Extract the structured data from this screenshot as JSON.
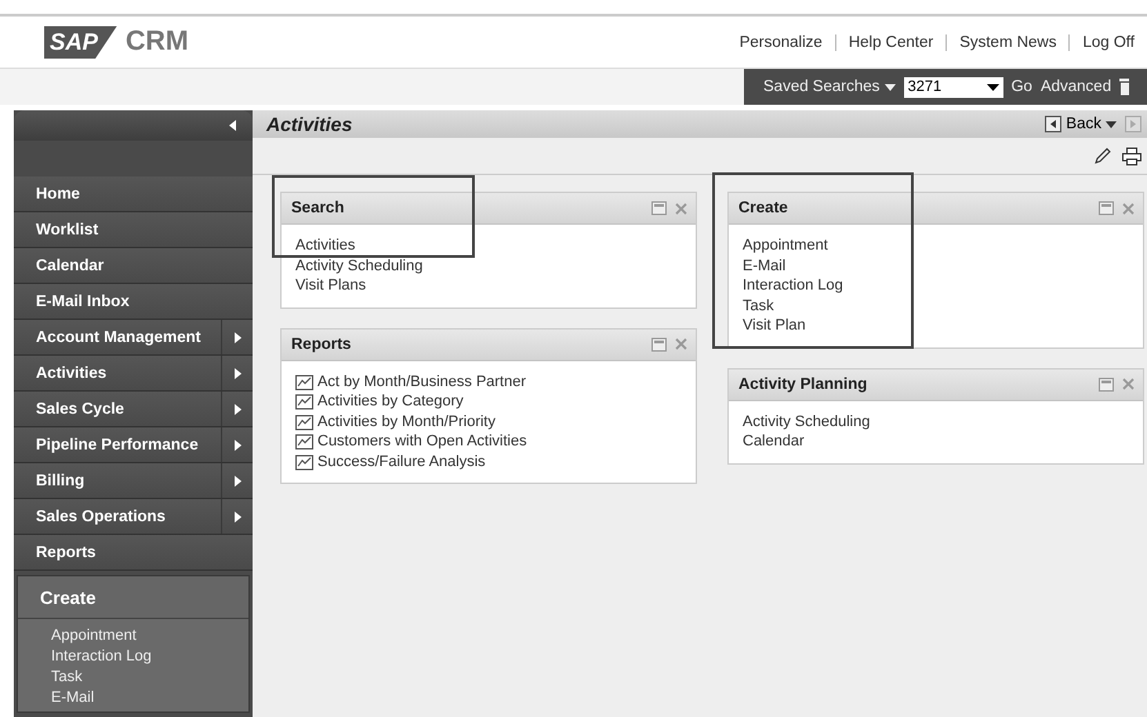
{
  "header": {
    "logo": {
      "mark": "SAP",
      "product": "CRM"
    },
    "links": [
      "Personalize",
      "Help Center",
      "System News",
      "Log Off"
    ]
  },
  "search_bar": {
    "saved_searches": "Saved Searches",
    "value": "3271",
    "go": "Go",
    "advanced": "Advanced"
  },
  "page": {
    "title": "Activities",
    "back": "Back"
  },
  "sidebar": {
    "items": [
      {
        "label": "Home",
        "has_submenu": false
      },
      {
        "label": "Worklist",
        "has_submenu": false
      },
      {
        "label": "Calendar",
        "has_submenu": false
      },
      {
        "label": "E-Mail Inbox",
        "has_submenu": false
      },
      {
        "label": "Account Management",
        "has_submenu": true
      },
      {
        "label": "Activities",
        "has_submenu": true
      },
      {
        "label": "Sales Cycle",
        "has_submenu": true
      },
      {
        "label": "Pipeline Performance",
        "has_submenu": true
      },
      {
        "label": "Billing",
        "has_submenu": true
      },
      {
        "label": "Sales Operations",
        "has_submenu": true
      },
      {
        "label": "Reports",
        "has_submenu": false
      }
    ],
    "create": {
      "title": "Create",
      "items": [
        "Appointment",
        "Interaction Log",
        "Task",
        "E-Mail"
      ]
    }
  },
  "columns": [
    [
      {
        "title": "Search",
        "highlighted": true,
        "kind": "link",
        "items": [
          "Activities",
          "Activity Scheduling",
          "Visit Plans"
        ]
      },
      {
        "title": "Reports",
        "highlighted": false,
        "kind": "report",
        "items": [
          "Act by Month/Business Partner",
          "Activities by Category",
          "Activities by Month/Priority",
          "Customers with Open Activities",
          "Success/Failure Analysis"
        ]
      }
    ],
    [
      {
        "title": "Create",
        "highlighted": true,
        "kind": "link",
        "items": [
          "Appointment",
          "E-Mail",
          "Interaction Log",
          "Task",
          "Visit Plan"
        ]
      },
      {
        "title": "Activity Planning",
        "highlighted": false,
        "kind": "link",
        "items": [
          "Activity Scheduling",
          "Calendar"
        ]
      }
    ]
  ]
}
